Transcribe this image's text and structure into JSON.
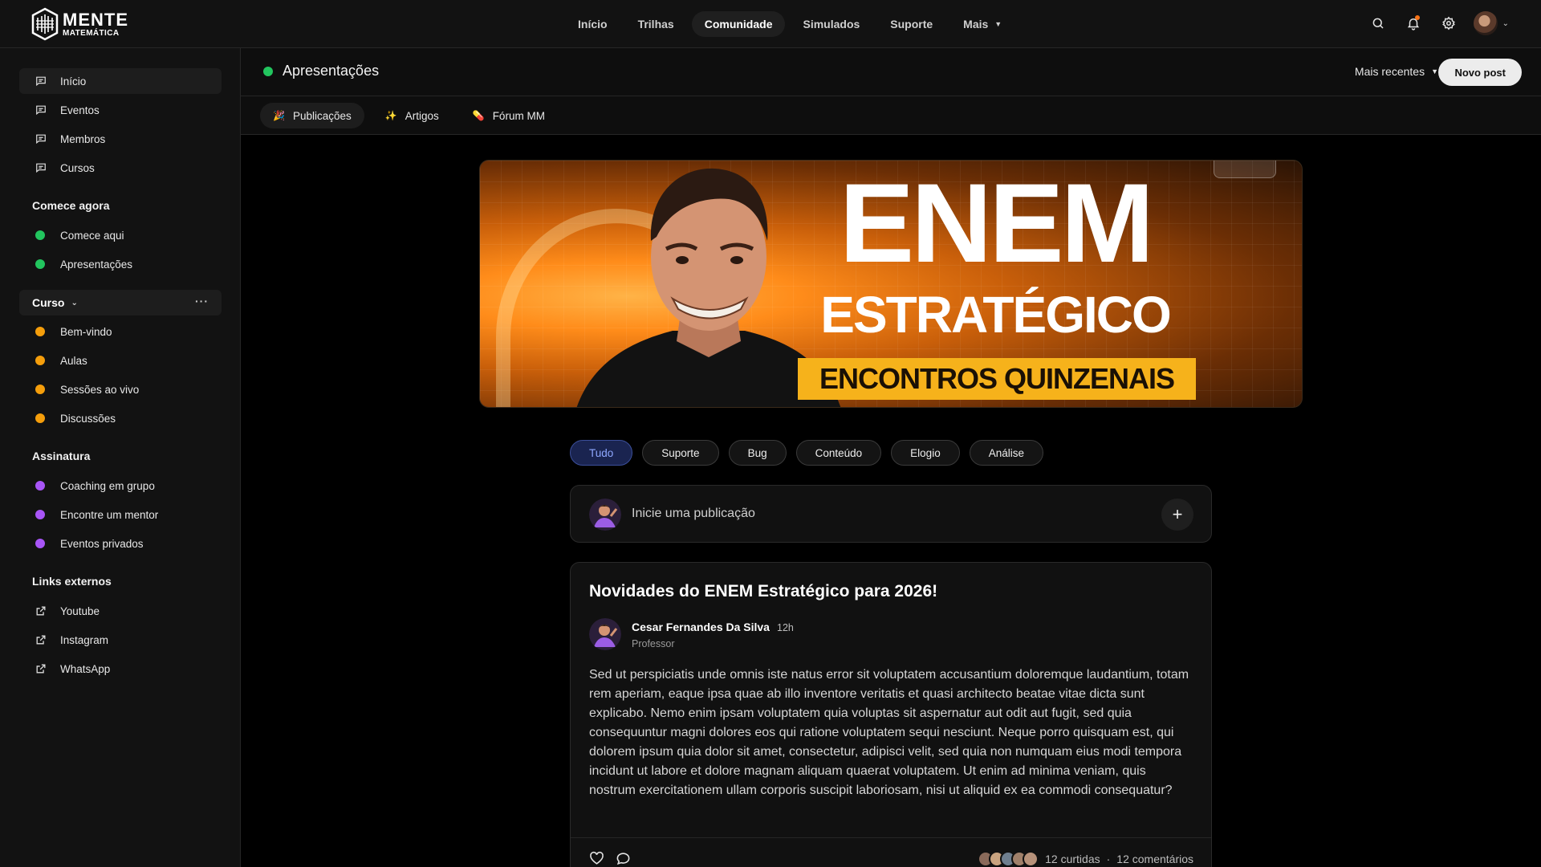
{
  "brand": {
    "line1": "MENTE",
    "line2": "MATEMÁTICA"
  },
  "nav": {
    "items": [
      {
        "label": "Início"
      },
      {
        "label": "Trilhas"
      },
      {
        "label": "Comunidade",
        "active": true
      },
      {
        "label": "Simulados"
      },
      {
        "label": "Suporte"
      },
      {
        "label": "Mais",
        "has_dropdown": true
      }
    ]
  },
  "top_icons": [
    "search-icon",
    "bell-icon",
    "gear-icon",
    "user-avatar"
  ],
  "sidebar": {
    "main": [
      {
        "label": "Início",
        "icon": "message-square-icon",
        "active": true
      },
      {
        "label": "Eventos",
        "icon": "message-square-icon"
      },
      {
        "label": "Membros",
        "icon": "message-square-icon"
      },
      {
        "label": "Cursos",
        "icon": "message-square-icon"
      }
    ],
    "sections": [
      {
        "title": "Comece agora",
        "items": [
          {
            "label": "Comece aqui",
            "color": "#22c55e"
          },
          {
            "label": "Apresentações",
            "color": "#22c55e"
          }
        ]
      },
      {
        "title": "Curso",
        "collapsible": true,
        "items": [
          {
            "label": "Bem-vindo",
            "color": "#f59e0b"
          },
          {
            "label": "Aulas",
            "color": "#f59e0b"
          },
          {
            "label": "Sessões ao vivo",
            "color": "#f59e0b"
          },
          {
            "label": "Discussões",
            "color": "#f59e0b"
          }
        ]
      },
      {
        "title": "Assinatura",
        "items": [
          {
            "label": "Coaching em grupo",
            "color": "#a855f7"
          },
          {
            "label": "Encontre um mentor",
            "color": "#a855f7"
          },
          {
            "label": "Eventos privados",
            "color": "#a855f7"
          }
        ]
      },
      {
        "title": "Links externos",
        "items": [
          {
            "label": "Youtube",
            "icon": "external-link-icon"
          },
          {
            "label": "Instagram",
            "icon": "external-link-icon"
          },
          {
            "label": "WhatsApp",
            "icon": "external-link-icon"
          }
        ]
      }
    ]
  },
  "header": {
    "title": "Apresentações",
    "status_color": "#22c55e",
    "sort_label": "Mais recentes",
    "new_post_label": "Novo post"
  },
  "tabs": [
    {
      "label": "Publicações",
      "emoji": "🎉",
      "active": true
    },
    {
      "label": "Artigos",
      "emoji": "✨"
    },
    {
      "label": "Fórum MM",
      "emoji": "💊"
    }
  ],
  "banner": {
    "title_line1": "ENEM",
    "title_line2": "ESTRATÉGICO",
    "title_line3": "ENCONTROS QUINZENAIS"
  },
  "filters": [
    {
      "label": "Tudo",
      "active": true
    },
    {
      "label": "Suporte"
    },
    {
      "label": "Bug"
    },
    {
      "label": "Conteúdo"
    },
    {
      "label": "Elogio"
    },
    {
      "label": "Análise"
    }
  ],
  "composer": {
    "placeholder": "Inicie uma publicação",
    "plus": "+"
  },
  "post": {
    "title": "Novidades do ENEM Estratégico para 2026!",
    "author": "Cesar Fernandes Da Silva",
    "time": "12h",
    "role": "Professor",
    "body": "Sed ut perspiciatis unde omnis iste natus error sit voluptatem accusantium doloremque laudantium, totam rem aperiam, eaque ipsa quae ab illo inventore veritatis et quasi architecto beatae vitae dicta sunt explicabo. Nemo enim ipsam voluptatem quia voluptas sit aspernatur aut odit aut fugit, sed quia consequuntur magni dolores eos qui ratione voluptatem sequi nesciunt. Neque porro quisquam est, qui dolorem ipsum quia dolor sit amet, consectetur, adipisci velit, sed quia non numquam eius modi tempora incidunt ut labore et dolore magnam aliquam quaerat voluptatem. Ut enim ad minima veniam, quis nostrum exercitationem ullam corporis suscipit laboriosam, nisi ut aliquid ex ea commodi consequatur?",
    "likes": "12 curtidas",
    "separator": "·",
    "comments": "12 comentários"
  },
  "colors": {
    "accent_blue": "#8fa8ff",
    "green": "#22c55e",
    "orange": "#f59e0b",
    "purple": "#a855f7",
    "banner_yellow": "#f6b21b"
  }
}
